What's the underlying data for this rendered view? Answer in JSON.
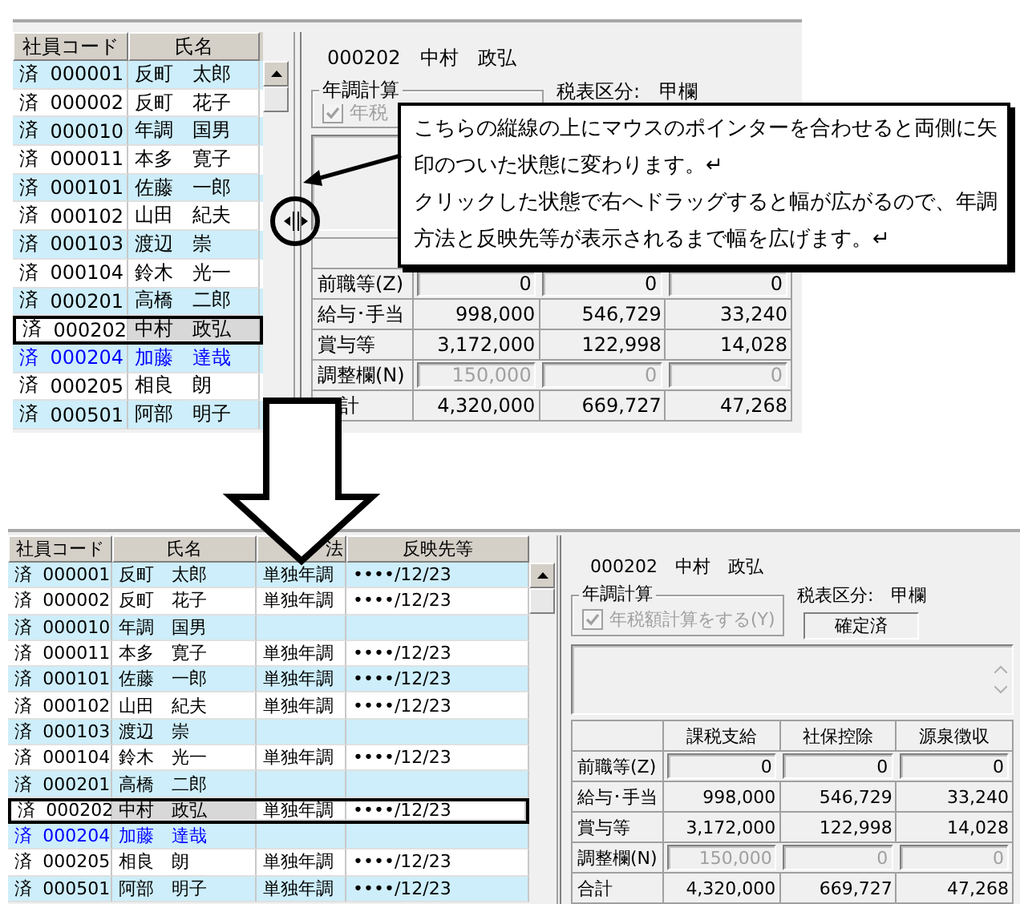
{
  "top": {
    "list": {
      "columns": [
        "社員コード",
        "氏名"
      ],
      "rows": [
        {
          "status": "済",
          "code": "000001",
          "name": "反町　太郎",
          "color": "#000000",
          "selected": false
        },
        {
          "status": "済",
          "code": "000002",
          "name": "反町　花子",
          "color": "#000000",
          "selected": false
        },
        {
          "status": "済",
          "code": "000010",
          "name": "年調　国男",
          "color": "#000000",
          "selected": false
        },
        {
          "status": "済",
          "code": "000011",
          "name": "本多　寛子",
          "color": "#000000",
          "selected": false
        },
        {
          "status": "済",
          "code": "000101",
          "name": "佐藤　一郎",
          "color": "#000000",
          "selected": false
        },
        {
          "status": "済",
          "code": "000102",
          "name": "山田　紀夫",
          "color": "#000000",
          "selected": false
        },
        {
          "status": "済",
          "code": "000103",
          "name": "渡辺　崇",
          "color": "#000000",
          "selected": false
        },
        {
          "status": "済",
          "code": "000104",
          "name": "鈴木　光一",
          "color": "#000000",
          "selected": false
        },
        {
          "status": "済",
          "code": "000201",
          "name": "高橋　二郎",
          "color": "#000000",
          "selected": false
        },
        {
          "status": "済",
          "code": "000202",
          "name": "中村　政弘",
          "color": "#000000",
          "selected": true
        },
        {
          "status": "済",
          "code": "000204",
          "name": "加藤　達哉",
          "color": "#0000ff",
          "selected": false
        },
        {
          "status": "済",
          "code": "000205",
          "name": "相良　朗",
          "color": "#000000",
          "selected": false
        },
        {
          "status": "済",
          "code": "000501",
          "name": "阿部　明子",
          "color": "#000000",
          "selected": false
        }
      ]
    },
    "detail": {
      "employee": "000202　中村　政弘",
      "group_label": "年調計算",
      "checkbox": {
        "label": "年税",
        "checked": true,
        "disabled": true
      },
      "tax_class": "税表区分:　甲欄",
      "table": {
        "rows": [
          {
            "label": "前職等(Z)",
            "kind": "input",
            "disabled": false,
            "values": [
              "0",
              "0",
              "0"
            ]
          },
          {
            "label": "給与･手当",
            "kind": "value",
            "disabled": false,
            "values": [
              "998,000",
              "546,729",
              "33,240"
            ]
          },
          {
            "label": "賞与等",
            "kind": "value",
            "disabled": false,
            "values": [
              "3,172,000",
              "122,998",
              "14,028"
            ]
          },
          {
            "label": "調整欄(N)",
            "kind": "input",
            "disabled": true,
            "values": [
              "150,000",
              "0",
              "0"
            ]
          },
          {
            "label": "計",
            "kind": "value",
            "disabled": false,
            "values": [
              "4,320,000",
              "669,727",
              "47,268"
            ]
          }
        ]
      }
    }
  },
  "callout": {
    "paragraphs": [
      "こちらの縦線の上にマウスのポインターを合わせると両側に矢印のついた状態に変わります。↵",
      "クリックした状態で右へドラッグすると幅が広がるので、年調方法と反映先等が表示されるまで幅を広げます。↵"
    ]
  },
  "bottom": {
    "list": {
      "columns": [
        "社員コード",
        "氏名",
        "法",
        "反映先等"
      ],
      "rows": [
        {
          "status": "済",
          "code": "000001",
          "name": "反町　太郎",
          "method": "単独年調",
          "dest": "••••/12/23",
          "color": "#000000",
          "selected": false
        },
        {
          "status": "済",
          "code": "000002",
          "name": "反町　花子",
          "method": "単独年調",
          "dest": "••••/12/23",
          "color": "#000000",
          "selected": false
        },
        {
          "status": "済",
          "code": "000010",
          "name": "年調　国男",
          "color": "#000000",
          "selected": false
        },
        {
          "status": "済",
          "code": "000011",
          "name": "本多　寛子",
          "method": "単独年調",
          "dest": "••••/12/23",
          "color": "#000000",
          "selected": false
        },
        {
          "status": "済",
          "code": "000101",
          "name": "佐藤　一郎",
          "method": "単独年調",
          "dest": "••••/12/23",
          "color": "#000000",
          "selected": false
        },
        {
          "status": "済",
          "code": "000102",
          "name": "山田　紀夫",
          "method": "単独年調",
          "dest": "••••/12/23",
          "color": "#000000",
          "selected": false
        },
        {
          "status": "済",
          "code": "000103",
          "name": "渡辺　崇",
          "color": "#000000",
          "selected": false
        },
        {
          "status": "済",
          "code": "000104",
          "name": "鈴木　光一",
          "method": "単独年調",
          "dest": "••••/12/23",
          "color": "#000000",
          "selected": false
        },
        {
          "status": "済",
          "code": "000201",
          "name": "高橋　二郎",
          "color": "#000000",
          "selected": false
        },
        {
          "status": "済",
          "code": "000202",
          "name": "中村　政弘",
          "method": "単独年調",
          "dest": "••••/12/23",
          "color": "#000000",
          "selected": true
        },
        {
          "status": "済",
          "code": "000204",
          "name": "加藤　達哉",
          "color": "#0000ff",
          "selected": false
        },
        {
          "status": "済",
          "code": "000205",
          "name": "相良　朗",
          "method": "単独年調",
          "dest": "••••/12/23",
          "color": "#000000",
          "selected": false
        },
        {
          "status": "済",
          "code": "000501",
          "name": "阿部　明子",
          "method": "単独年調",
          "dest": "••••/12/23",
          "color": "#000000",
          "selected": false
        }
      ]
    },
    "detail": {
      "employee": "000202　中村　政弘",
      "group_label": "年調計算",
      "checkbox": {
        "label": "年税額計算をする(Y)",
        "checked": true,
        "disabled": true
      },
      "tax_class": "税表区分:　甲欄",
      "status": "確定済",
      "table": {
        "columns": [
          "課税支給",
          "社保控除",
          "源泉徴収"
        ],
        "rows": [
          {
            "label": "前職等(Z)",
            "kind": "input",
            "disabled": false,
            "values": [
              "0",
              "0",
              "0"
            ]
          },
          {
            "label": "給与･手当",
            "kind": "value",
            "disabled": false,
            "values": [
              "998,000",
              "546,729",
              "33,240"
            ]
          },
          {
            "label": "賞与等",
            "kind": "value",
            "disabled": false,
            "values": [
              "3,172,000",
              "122,998",
              "14,028"
            ]
          },
          {
            "label": "調整欄(N)",
            "kind": "input",
            "disabled": true,
            "values": [
              "150,000",
              "0",
              "0"
            ]
          },
          {
            "label": "合計",
            "kind": "value",
            "disabled": false,
            "values": [
              "4,320,000",
              "669,727",
              "47,268"
            ]
          }
        ]
      }
    }
  }
}
